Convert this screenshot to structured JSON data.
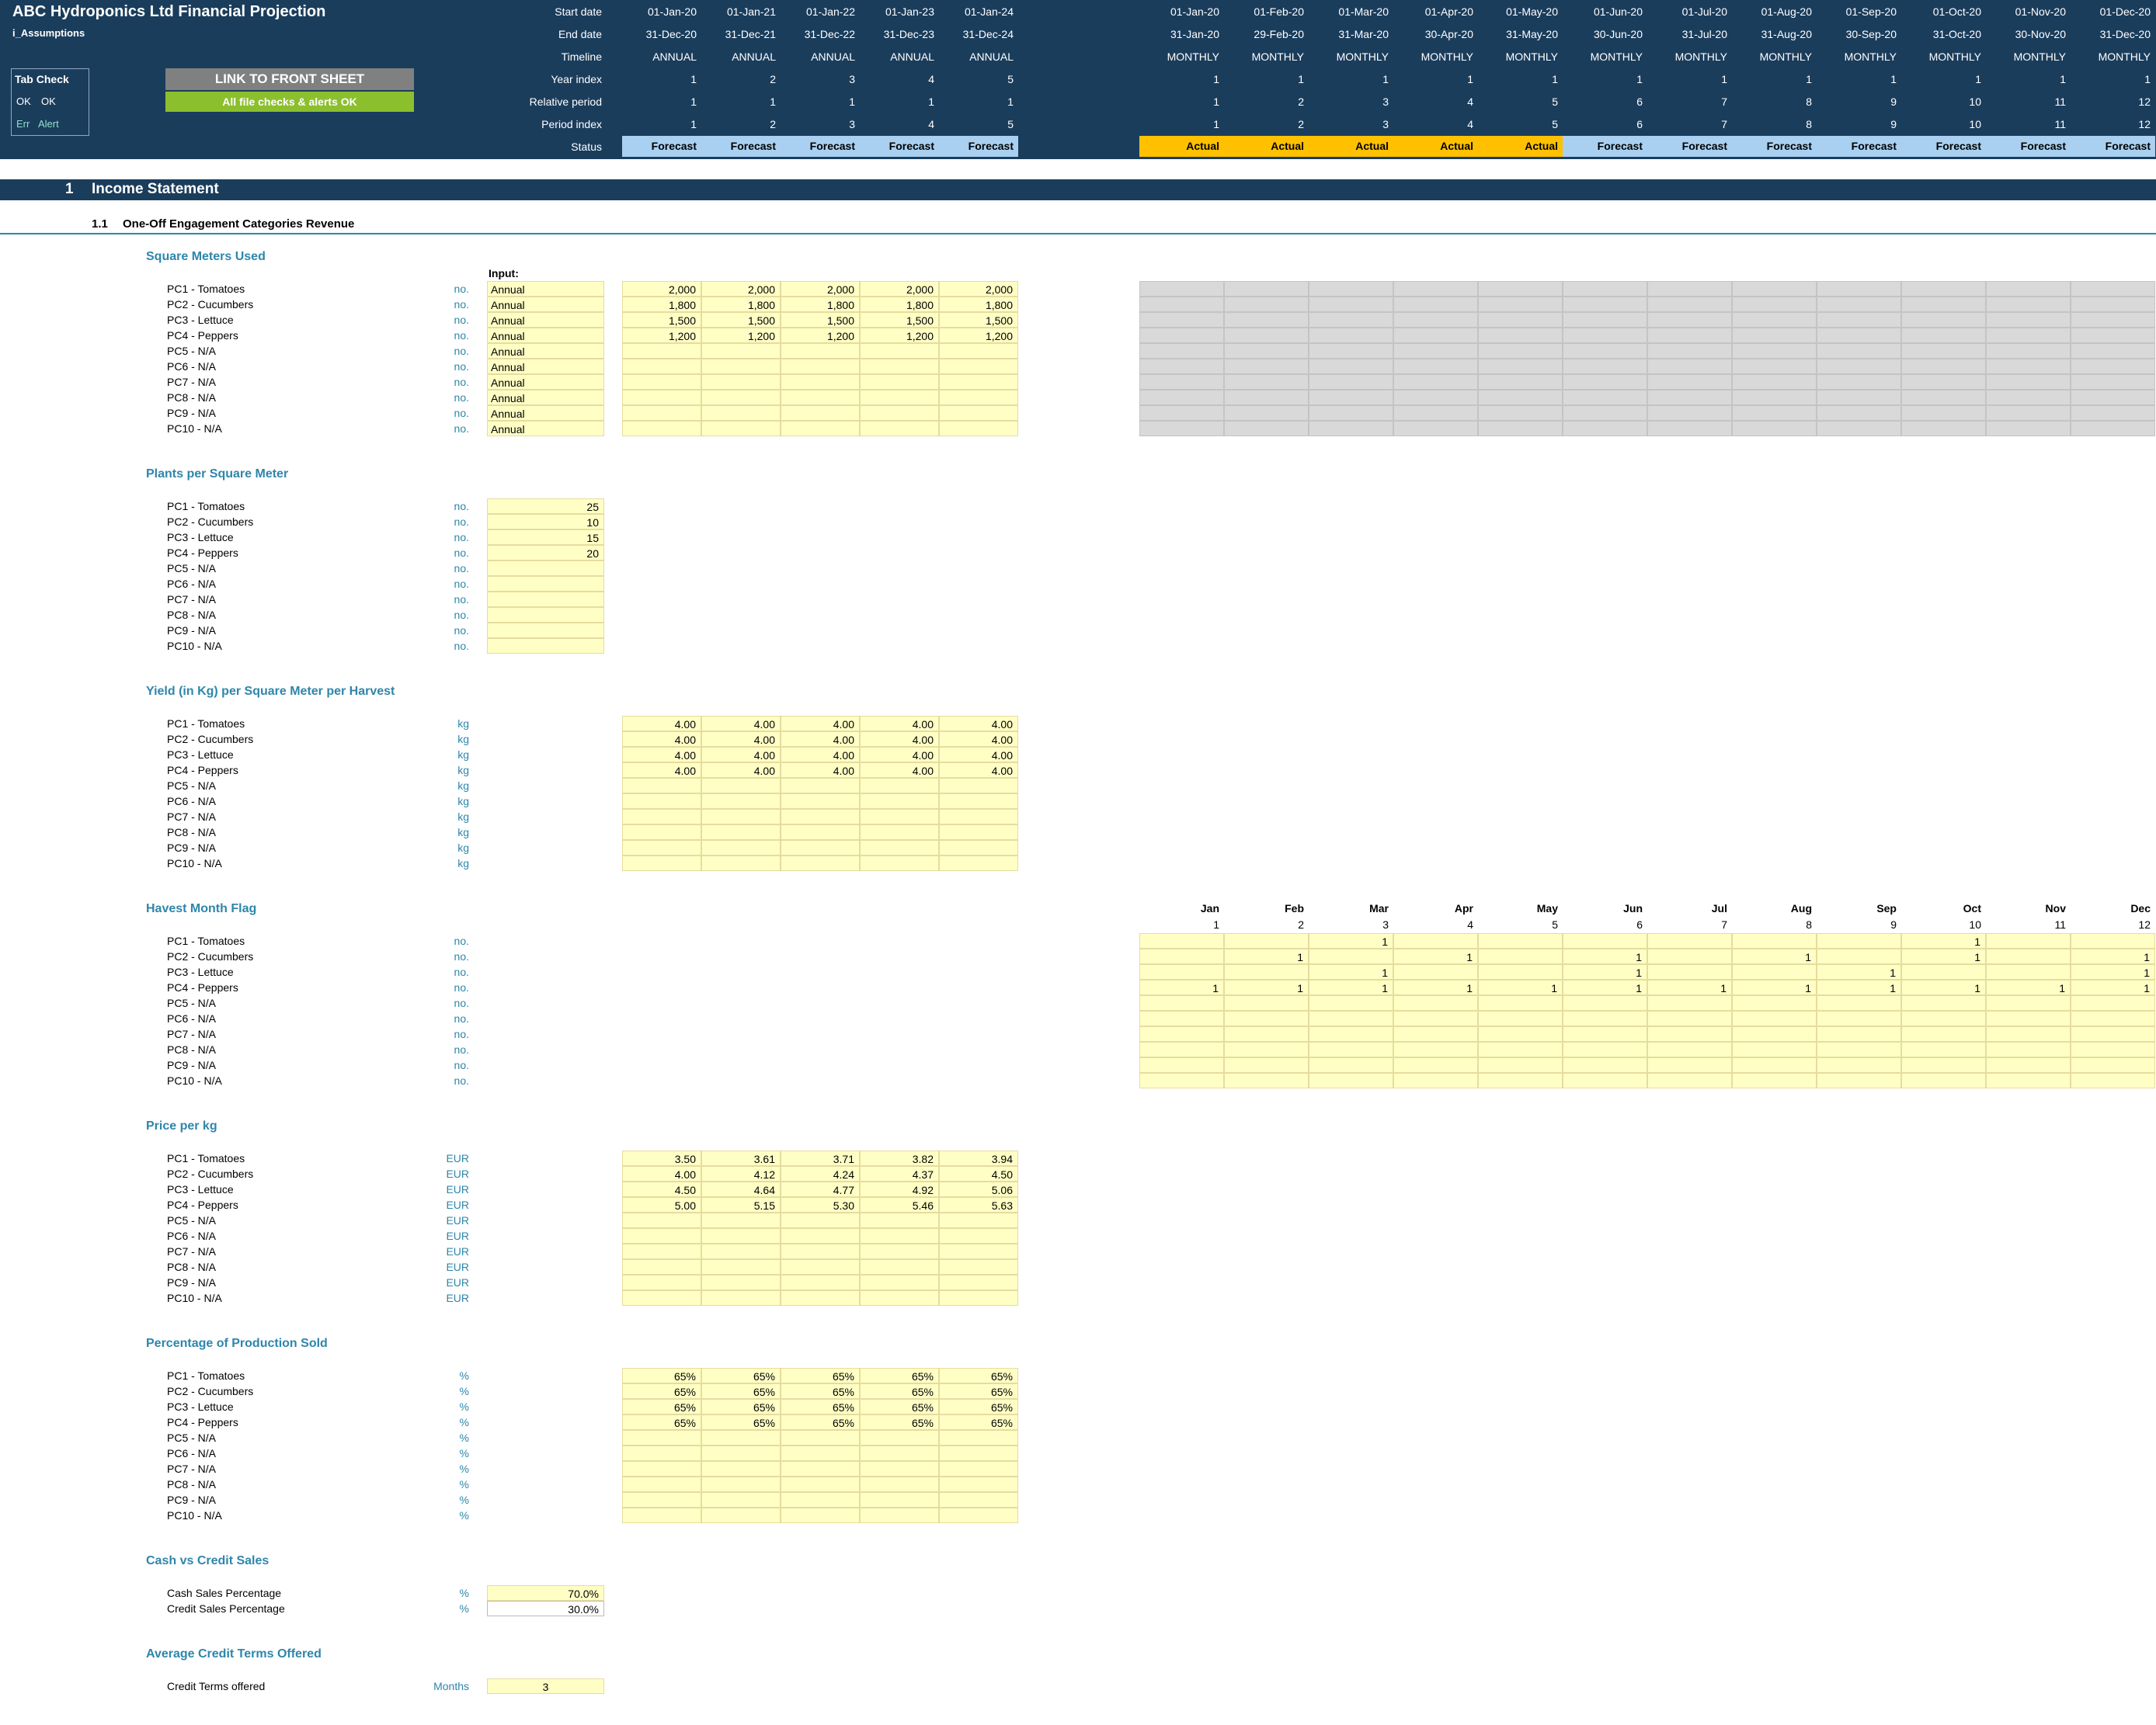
{
  "header": {
    "title": "ABC Hydroponics Ltd Financial Projection",
    "sheet": "i_Assumptions",
    "tab_check": {
      "title": "Tab Check",
      "ok1": "OK",
      "ok2": "OK",
      "err": "Err",
      "alert": "Alert"
    },
    "link_button": "LINK TO FRONT SHEET",
    "checks_status": "All file checks & alerts OK",
    "row_labels": [
      "Start date",
      "End date",
      "Timeline",
      "Year index",
      "Relative period",
      "Period index",
      "Status"
    ],
    "annual": {
      "start": [
        "01-Jan-20",
        "01-Jan-21",
        "01-Jan-22",
        "01-Jan-23",
        "01-Jan-24"
      ],
      "end": [
        "31-Dec-20",
        "31-Dec-21",
        "31-Dec-22",
        "31-Dec-23",
        "31-Dec-24"
      ],
      "timeline": [
        "ANNUAL",
        "ANNUAL",
        "ANNUAL",
        "ANNUAL",
        "ANNUAL"
      ],
      "year_index": [
        "1",
        "2",
        "3",
        "4",
        "5"
      ],
      "relative": [
        "1",
        "1",
        "1",
        "1",
        "1"
      ],
      "period": [
        "1",
        "2",
        "3",
        "4",
        "5"
      ],
      "status": [
        "Forecast",
        "Forecast",
        "Forecast",
        "Forecast",
        "Forecast"
      ]
    },
    "monthly": {
      "start": [
        "01-Jan-20",
        "01-Feb-20",
        "01-Mar-20",
        "01-Apr-20",
        "01-May-20",
        "01-Jun-20",
        "01-Jul-20",
        "01-Aug-20",
        "01-Sep-20",
        "01-Oct-20",
        "01-Nov-20",
        "01-Dec-20"
      ],
      "end": [
        "31-Jan-20",
        "29-Feb-20",
        "31-Mar-20",
        "30-Apr-20",
        "31-May-20",
        "30-Jun-20",
        "31-Jul-20",
        "31-Aug-20",
        "30-Sep-20",
        "31-Oct-20",
        "30-Nov-20",
        "31-Dec-20"
      ],
      "timeline": [
        "MONTHLY",
        "MONTHLY",
        "MONTHLY",
        "MONTHLY",
        "MONTHLY",
        "MONTHLY",
        "MONTHLY",
        "MONTHLY",
        "MONTHLY",
        "MONTHLY",
        "MONTHLY",
        "MONTHLY"
      ],
      "year_index": [
        "1",
        "1",
        "1",
        "1",
        "1",
        "1",
        "1",
        "1",
        "1",
        "1",
        "1",
        "1"
      ],
      "relative": [
        "1",
        "2",
        "3",
        "4",
        "5",
        "6",
        "7",
        "8",
        "9",
        "10",
        "11",
        "12"
      ],
      "period": [
        "1",
        "2",
        "3",
        "4",
        "5",
        "6",
        "7",
        "8",
        "9",
        "10",
        "11",
        "12"
      ],
      "status": [
        "Actual",
        "Actual",
        "Actual",
        "Actual",
        "Actual",
        "Forecast",
        "Forecast",
        "Forecast",
        "Forecast",
        "Forecast",
        "Forecast",
        "Forecast"
      ]
    }
  },
  "colors": {
    "header_bg": "#1b3d5c",
    "forecast": "#a9d0f0",
    "actual": "#ffc000",
    "input": "#ffffc5",
    "link_btn": "#808080",
    "ok_btn": "#8cbf2d",
    "section_text": "#2e86ab"
  },
  "section": {
    "num": "1",
    "title": "Income Statement",
    "sub_num": "1.1",
    "sub_title": "One-Off Engagement Categories Revenue"
  },
  "input_header": "Input:",
  "products": [
    "PC1 - Tomatoes",
    "PC2 - Cucumbers",
    "PC3 - Lettuce",
    "PC4 - Peppers",
    "PC5 - N/A",
    "PC6 - N/A",
    "PC7 - N/A",
    "PC8 - N/A",
    "PC9 - N/A",
    "PC10 - N/A"
  ],
  "sq_meters": {
    "title": "Square Meters Used",
    "unit": "no.",
    "flag": "Annual",
    "values": [
      [
        "2,000",
        "2,000",
        "2,000",
        "2,000",
        "2,000"
      ],
      [
        "1,800",
        "1,800",
        "1,800",
        "1,800",
        "1,800"
      ],
      [
        "1,500",
        "1,500",
        "1,500",
        "1,500",
        "1,500"
      ],
      [
        "1,200",
        "1,200",
        "1,200",
        "1,200",
        "1,200"
      ]
    ]
  },
  "plants": {
    "title": "Plants per Square Meter",
    "unit": "no.",
    "values": [
      "25",
      "10",
      "15",
      "20"
    ]
  },
  "yield": {
    "title": "Yield (in Kg) per Square Meter per Harvest",
    "unit": "kg",
    "values": [
      [
        "4.00",
        "4.00",
        "4.00",
        "4.00",
        "4.00"
      ],
      [
        "4.00",
        "4.00",
        "4.00",
        "4.00",
        "4.00"
      ],
      [
        "4.00",
        "4.00",
        "4.00",
        "4.00",
        "4.00"
      ],
      [
        "4.00",
        "4.00",
        "4.00",
        "4.00",
        "4.00"
      ]
    ]
  },
  "harvest": {
    "title": "Havest Month Flag",
    "unit": "no.",
    "months": [
      "Jan",
      "Feb",
      "Mar",
      "Apr",
      "May",
      "Jun",
      "Jul",
      "Aug",
      "Sep",
      "Oct",
      "Nov",
      "Dec"
    ],
    "month_nums": [
      "1",
      "2",
      "3",
      "4",
      "5",
      "6",
      "7",
      "8",
      "9",
      "10",
      "11",
      "12"
    ],
    "flags": [
      [
        "",
        "",
        "1",
        "",
        "",
        "",
        "",
        "",
        "",
        "1",
        "",
        ""
      ],
      [
        "",
        "1",
        "",
        "1",
        "",
        "1",
        "",
        "1",
        "",
        "1",
        "",
        "1"
      ],
      [
        "",
        "",
        "1",
        "",
        "",
        "1",
        "",
        "",
        "1",
        "",
        "",
        "1"
      ],
      [
        "1",
        "1",
        "1",
        "1",
        "1",
        "1",
        "1",
        "1",
        "1",
        "1",
        "1",
        "1"
      ]
    ]
  },
  "price": {
    "title": "Price per kg",
    "unit": "EUR",
    "values": [
      [
        "3.50",
        "3.61",
        "3.71",
        "3.82",
        "3.94"
      ],
      [
        "4.00",
        "4.12",
        "4.24",
        "4.37",
        "4.50"
      ],
      [
        "4.50",
        "4.64",
        "4.77",
        "4.92",
        "5.06"
      ],
      [
        "5.00",
        "5.15",
        "5.30",
        "5.46",
        "5.63"
      ]
    ]
  },
  "pct_sold": {
    "title": "Percentage of Production Sold",
    "unit": "%",
    "values": [
      [
        "65%",
        "65%",
        "65%",
        "65%",
        "65%"
      ],
      [
        "65%",
        "65%",
        "65%",
        "65%",
        "65%"
      ],
      [
        "65%",
        "65%",
        "65%",
        "65%",
        "65%"
      ],
      [
        "65%",
        "65%",
        "65%",
        "65%",
        "65%"
      ]
    ]
  },
  "cash_credit": {
    "title": "Cash vs Credit Sales",
    "unit": "%",
    "rows": [
      {
        "label": "Cash Sales Percentage",
        "value": "70.0%"
      },
      {
        "label": "Credit Sales Percentage",
        "value": "30.0%"
      }
    ]
  },
  "credit_terms": {
    "title": "Average Credit Terms Offered",
    "label": "Credit Terms offered",
    "unit": "Months",
    "value": "3"
  }
}
